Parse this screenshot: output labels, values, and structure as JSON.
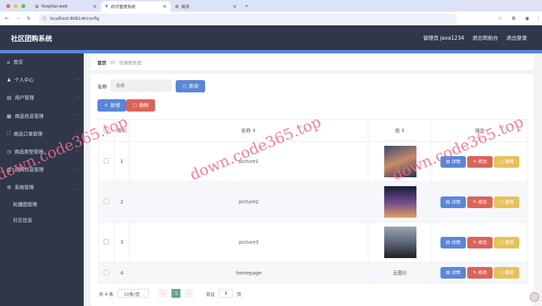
{
  "browser": {
    "tabs": [
      {
        "title": "hospital-web",
        "active": false
      },
      {
        "title": "后台管理系统",
        "active": true
      },
      {
        "title": "首页",
        "active": false
      }
    ],
    "url": "localhost:8081/#/config"
  },
  "header": {
    "title": "社区团购系统",
    "user": "管理员 java1234",
    "to_front": "退出到前台",
    "logout": "退出登录"
  },
  "sidebar": {
    "items": [
      {
        "label": "首页",
        "icon": "home-icon",
        "glyph": "⌂"
      },
      {
        "label": "个人中心",
        "icon": "user-icon",
        "glyph": "♟"
      },
      {
        "label": "用户管理",
        "icon": "briefcase-icon",
        "glyph": "▤"
      },
      {
        "label": "商品信息管理",
        "icon": "clipboard-icon",
        "glyph": "▦"
      },
      {
        "label": "商品订单管理",
        "icon": "frame-icon",
        "glyph": "⛶"
      },
      {
        "label": "商品类型管理",
        "icon": "clock-icon",
        "glyph": "◷"
      },
      {
        "label": "团购信息管理",
        "icon": "chart-icon",
        "glyph": "▥"
      },
      {
        "label": "系统管理",
        "icon": "gear-icon",
        "glyph": "⚙"
      }
    ],
    "subitems": [
      "轮播图管理",
      "社区信息"
    ]
  },
  "breadcrumb": {
    "home": "首页",
    "current": "轮播图管理"
  },
  "search": {
    "label": "名称",
    "placeholder": "名称",
    "button": "查询"
  },
  "toolbar": {
    "add": "新增",
    "delete": "删除"
  },
  "table": {
    "headers": {
      "index": "索引",
      "name": "名称 ⇕",
      "value": "值 ⇕",
      "actions": "操作"
    },
    "rows": [
      {
        "index": "1",
        "name": "picture1",
        "value": "",
        "has_image": true
      },
      {
        "index": "2",
        "name": "picture2",
        "value": "",
        "has_image": true
      },
      {
        "index": "3",
        "name": "picture3",
        "value": "",
        "has_image": true
      },
      {
        "index": "4",
        "name": "homepage",
        "value": "无图片",
        "has_image": false
      }
    ],
    "actions": {
      "detail": "详情",
      "edit": "修改",
      "delete": "删除"
    }
  },
  "pagination": {
    "total": "共 4 条",
    "page_size": "10条/页",
    "current": "1",
    "goto_label": "前往",
    "goto_value": "1",
    "page_suffix": "页"
  },
  "watermark": "down.code365.top",
  "colors": {
    "primary": "#5b86d8",
    "danger": "#d9645a",
    "warning": "#e6c25a",
    "success": "#6aa786",
    "dark": "#30374a"
  }
}
